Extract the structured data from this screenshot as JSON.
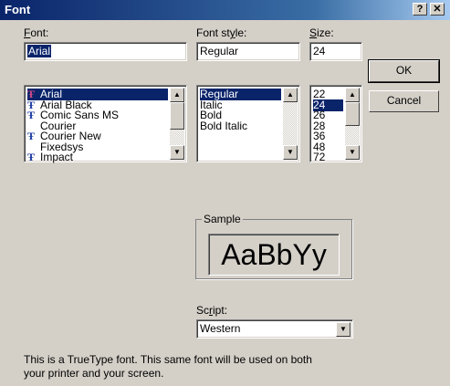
{
  "window": {
    "title": "Font",
    "help_label": "?",
    "close_label": "✕"
  },
  "font": {
    "label_prefix": "",
    "label_hot": "F",
    "label_rest": "ont:",
    "value": "Arial",
    "items": [
      {
        "name": "Arial",
        "icon": "truetype-icon",
        "selected": true
      },
      {
        "name": "Arial Black",
        "icon": "truetype-icon"
      },
      {
        "name": "Comic Sans MS",
        "icon": "truetype-icon"
      },
      {
        "name": "Courier",
        "icon": ""
      },
      {
        "name": "Courier New",
        "icon": "truetype-icon"
      },
      {
        "name": "Fixedsys",
        "icon": ""
      },
      {
        "name": "Impact",
        "icon": "truetype-icon"
      }
    ]
  },
  "style": {
    "label_prefix": "Font st",
    "label_hot": "y",
    "label_rest": "le:",
    "value": "Regular",
    "items": [
      {
        "name": "Regular",
        "selected": true
      },
      {
        "name": "Italic"
      },
      {
        "name": "Bold"
      },
      {
        "name": "Bold Italic"
      }
    ]
  },
  "size": {
    "label_prefix": "",
    "label_hot": "S",
    "label_rest": "ize:",
    "value": "24",
    "items": [
      {
        "name": "22"
      },
      {
        "name": "24",
        "selected": true
      },
      {
        "name": "26"
      },
      {
        "name": "28"
      },
      {
        "name": "36"
      },
      {
        "name": "48"
      },
      {
        "name": "72"
      }
    ]
  },
  "buttons": {
    "ok": "OK",
    "cancel": "Cancel"
  },
  "sample": {
    "label": "Sample",
    "text": "AaBbYy"
  },
  "script": {
    "label_prefix": "Sc",
    "label_hot": "r",
    "label_rest": "ipt:",
    "value": "Western"
  },
  "description": {
    "line1": "This is a TrueType font. This same font will be used on both",
    "line2": "your printer and your screen."
  },
  "icons": {
    "truetype_glyph": "Ŧ",
    "arrow_up": "▲",
    "arrow_down": "▼"
  },
  "colors": {
    "title_bar": "#0a246a",
    "selection": "#0a246a",
    "face": "#d4d0c8"
  }
}
